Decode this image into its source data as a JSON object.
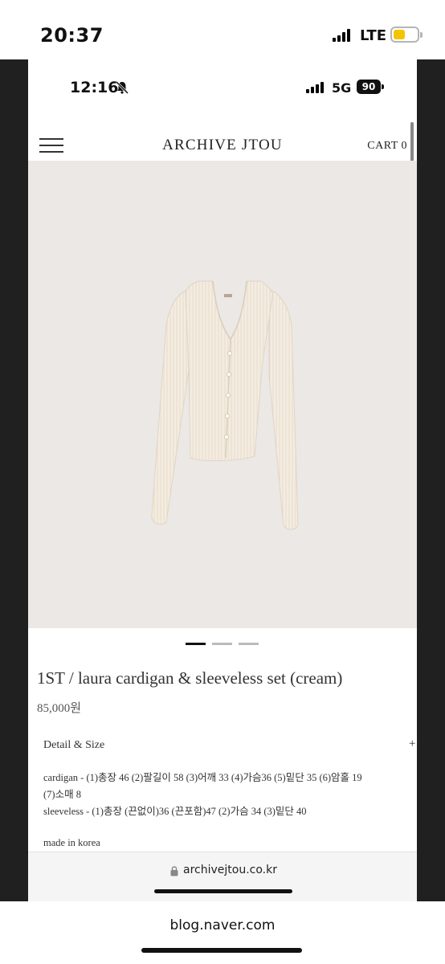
{
  "outer_status": {
    "time": "20:37",
    "network": "LTE"
  },
  "inner_status": {
    "time": "12:16",
    "network": "5G",
    "battery": "90"
  },
  "site": {
    "logo": "ARCHIVE JTOU",
    "cart": "CART 0"
  },
  "product": {
    "title": "1ST / laura cardigan & sleeveless set (cream)",
    "price": "85,000원",
    "image_count": 3,
    "active_image": 1
  },
  "details": {
    "heading": "Detail & Size",
    "toggle": "+",
    "cardigan_line1": "cardigan - (1)총장 46 (2)팔길이 58 (3)어깨 33 (4)가슴36 (5)밑단 35 (6)암홀 19",
    "cardigan_line2": "(7)소매 8",
    "sleeveless_line": "sleeveless - (1)총장 (끈없이)36 (끈포함)47 (2)가슴 34 (3)밑단 40",
    "made_in": "made in korea"
  },
  "browser": {
    "url": "archivejtou.co.kr"
  },
  "footer": {
    "url": "blog.naver.com"
  },
  "colors": {
    "battery_yellow": "#f5c400",
    "image_bg": "#ebe8e6",
    "garment": "#f4ece0"
  }
}
